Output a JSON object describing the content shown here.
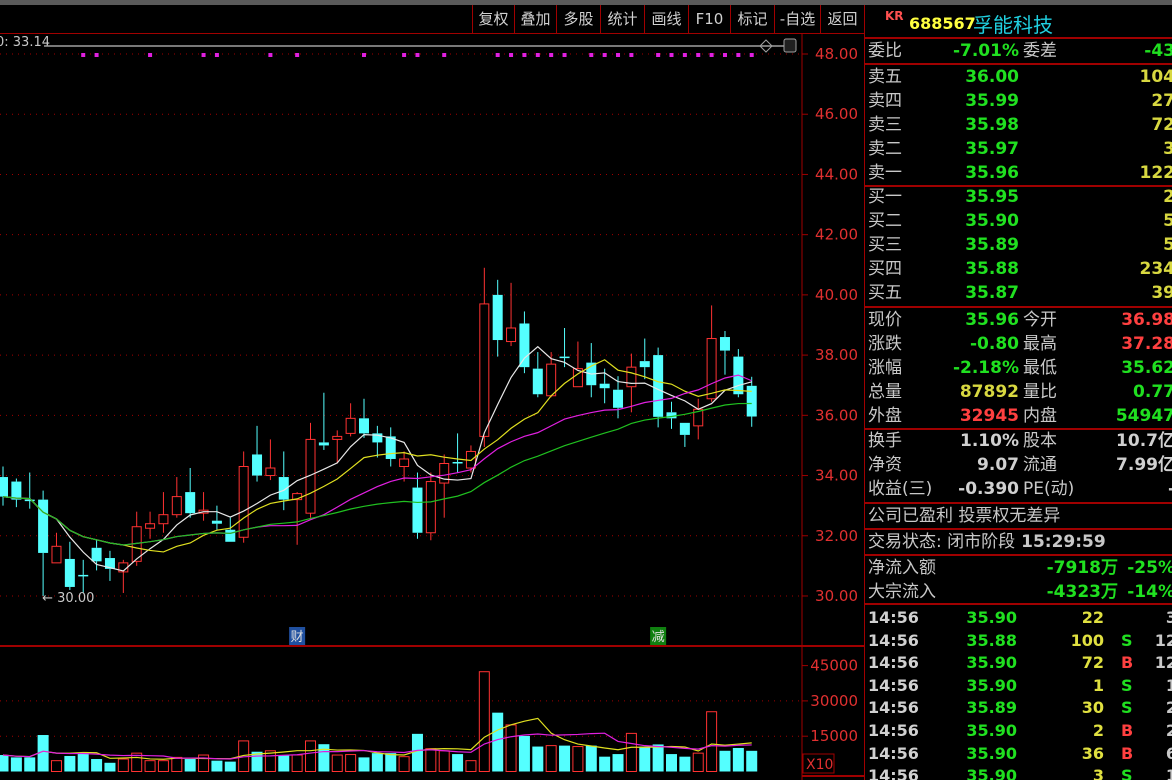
{
  "toolbar": {
    "buttons": [
      "复权",
      "叠加",
      "多股",
      "统计",
      "画线",
      "F10",
      "标记",
      "-自选",
      "返回"
    ]
  },
  "chart_header": {
    "ma_readout": "0: 33.14"
  },
  "stock": {
    "market_tag": "KR",
    "code": "688567",
    "name": "孚能科技"
  },
  "order_book": {
    "weibi": {
      "label": "委比",
      "value": "-7.01%",
      "label2": "委差",
      "value2": "-43"
    },
    "asks": [
      {
        "label": "卖五",
        "price": "36.00",
        "volume": "104"
      },
      {
        "label": "卖四",
        "price": "35.99",
        "volume": "27"
      },
      {
        "label": "卖三",
        "price": "35.98",
        "volume": "72"
      },
      {
        "label": "卖二",
        "price": "35.97",
        "volume": "3"
      },
      {
        "label": "卖一",
        "price": "35.96",
        "volume": "122"
      }
    ],
    "bids": [
      {
        "label": "买一",
        "price": "35.95",
        "volume": "2"
      },
      {
        "label": "买二",
        "price": "35.90",
        "volume": "5"
      },
      {
        "label": "买三",
        "price": "35.89",
        "volume": "5"
      },
      {
        "label": "买四",
        "price": "35.88",
        "volume": "234"
      },
      {
        "label": "买五",
        "price": "35.87",
        "volume": "39"
      }
    ]
  },
  "quote": [
    {
      "label": "现价",
      "value": "35.96",
      "color": "#20e020",
      "label2": "今开",
      "value2": "36.98",
      "color2": "#ff4040"
    },
    {
      "label": "涨跌",
      "value": "-0.80",
      "color": "#20e020",
      "label2": "最高",
      "value2": "37.28",
      "color2": "#ff4040"
    },
    {
      "label": "涨幅",
      "value": "-2.18%",
      "color": "#20e020",
      "label2": "最低",
      "value2": "35.62",
      "color2": "#20e020"
    },
    {
      "label": "总量",
      "value": "87892",
      "color": "#d8d840",
      "label2": "量比",
      "value2": "0.77",
      "color2": "#20e020"
    },
    {
      "label": "外盘",
      "value": "32945",
      "color": "#ff4040",
      "label2": "内盘",
      "value2": "54947",
      "color2": "#20e020"
    }
  ],
  "fundamentals": [
    {
      "label": "换手",
      "value": "1.10%",
      "label2": "股本",
      "value2": "10.7亿"
    },
    {
      "label": "净资",
      "value": "9.07",
      "label2": "流通",
      "value2": "7.99亿"
    },
    {
      "label": "收益(三)",
      "value": "-0.390",
      "label2": "PE(动)",
      "value2": "-"
    }
  ],
  "notice": "公司已盈利 投票权无差异",
  "trade_status": {
    "label": "交易状态: 闭市阶段",
    "time": "15:29:59"
  },
  "fund_flow": [
    {
      "label": "净流入额",
      "value": "-7918万",
      "pct": "-25%"
    },
    {
      "label": "大宗流入",
      "value": "-4323万",
      "pct": "-14%"
    }
  ],
  "ticks": [
    {
      "time": "14:56",
      "price": "35.90",
      "volume": "22",
      "side": "",
      "count": "3"
    },
    {
      "time": "14:56",
      "price": "35.88",
      "volume": "100",
      "side": "S",
      "count": "12"
    },
    {
      "time": "14:56",
      "price": "35.90",
      "volume": "72",
      "side": "B",
      "count": "12"
    },
    {
      "time": "14:56",
      "price": "35.90",
      "volume": "1",
      "side": "S",
      "count": "1"
    },
    {
      "time": "14:56",
      "price": "35.89",
      "volume": "30",
      "side": "S",
      "count": "2"
    },
    {
      "time": "14:56",
      "price": "35.90",
      "volume": "2",
      "side": "B",
      "count": "2"
    },
    {
      "time": "14:56",
      "price": "35.90",
      "volume": "36",
      "side": "B",
      "count": "6"
    },
    {
      "time": "14:56",
      "price": "35.90",
      "volume": "3",
      "side": "S",
      "count": "1"
    }
  ],
  "colors": {
    "up": "#ff3232",
    "down": "#54ffff",
    "axis": "#a00000",
    "axis_text": "#e03030",
    "buy": "#ff4040",
    "sell": "#20e020"
  },
  "chart_data": {
    "type": "candlestick",
    "price_axis": {
      "ticks": [
        "48.00",
        "46.00",
        "44.00",
        "42.00",
        "40.00",
        "38.00",
        "36.00",
        "34.00",
        "32.00",
        "30.00"
      ],
      "range": [
        30,
        48
      ]
    },
    "volume_axis": {
      "ticks": [
        "45000",
        "30000",
        "15000"
      ],
      "range": [
        0,
        45000
      ],
      "unit_label": "X10"
    },
    "low_marker": "30.00",
    "event_markers": [
      {
        "index": 22,
        "text": "财",
        "color": "#2050a0"
      },
      {
        "index": 49,
        "text": "减",
        "color": "#108010"
      }
    ],
    "signal_dots": [
      6,
      7,
      11,
      15,
      16,
      20,
      22,
      27,
      30,
      31,
      33,
      37,
      38,
      39,
      40,
      41,
      42,
      44,
      45,
      46,
      47,
      49,
      50,
      51,
      52,
      53,
      54,
      55,
      56
    ],
    "ohlc": [
      [
        33.95,
        34.3,
        33.0,
        33.3
      ],
      [
        33.8,
        33.9,
        32.95,
        33.2
      ],
      [
        33.2,
        34.1,
        32.9,
        33.2
      ],
      [
        33.2,
        33.5,
        30.0,
        31.43
      ],
      [
        31.1,
        32.1,
        31.1,
        31.65
      ],
      [
        31.23,
        31.8,
        30.2,
        30.3
      ],
      [
        30.7,
        31.2,
        30.1,
        30.7
      ],
      [
        31.6,
        31.85,
        30.85,
        31.15
      ],
      [
        31.26,
        31.5,
        30.5,
        30.9
      ],
      [
        30.8,
        31.2,
        30.1,
        31.1
      ],
      [
        31.15,
        32.8,
        31.0,
        32.3
      ],
      [
        32.25,
        32.8,
        31.9,
        32.4
      ],
      [
        32.4,
        33.45,
        32.1,
        32.7
      ],
      [
        32.7,
        33.95,
        32.6,
        33.3
      ],
      [
        33.45,
        34.25,
        32.6,
        32.75
      ],
      [
        32.75,
        33.45,
        32.5,
        32.85
      ],
      [
        32.5,
        33.0,
        32.2,
        32.4
      ],
      [
        32.2,
        32.6,
        31.8,
        31.8
      ],
      [
        31.95,
        34.8,
        31.77,
        34.3
      ],
      [
        34.7,
        35.65,
        33.8,
        34.0
      ],
      [
        34.0,
        35.2,
        33.85,
        34.25
      ],
      [
        33.95,
        34.8,
        32.85,
        33.2
      ],
      [
        33.2,
        33.45,
        31.7,
        33.4
      ],
      [
        32.75,
        35.75,
        32.6,
        35.2
      ],
      [
        35.1,
        36.75,
        34.85,
        35.0
      ],
      [
        35.2,
        35.5,
        34.4,
        35.3
      ],
      [
        35.4,
        36.4,
        35.3,
        35.9
      ],
      [
        35.9,
        36.55,
        35.25,
        35.4
      ],
      [
        35.4,
        35.65,
        34.6,
        35.1
      ],
      [
        35.3,
        35.6,
        34.3,
        34.55
      ],
      [
        34.3,
        34.8,
        33.8,
        34.55
      ],
      [
        33.6,
        34.1,
        31.9,
        32.1
      ],
      [
        32.1,
        34.1,
        31.85,
        33.8
      ],
      [
        33.75,
        34.7,
        32.6,
        34.4
      ],
      [
        34.45,
        35.4,
        34.1,
        34.4
      ],
      [
        34.25,
        35.0,
        34.1,
        34.8
      ],
      [
        35.3,
        40.9,
        34.95,
        39.7
      ],
      [
        40.0,
        40.5,
        37.95,
        38.5
      ],
      [
        38.45,
        40.4,
        38.3,
        38.9
      ],
      [
        39.05,
        39.45,
        37.4,
        37.6
      ],
      [
        37.55,
        38.1,
        36.6,
        36.7
      ],
      [
        36.65,
        38.1,
        36.6,
        37.7
      ],
      [
        37.95,
        38.9,
        37.6,
        37.9
      ],
      [
        36.95,
        38.45,
        36.95,
        37.55
      ],
      [
        37.75,
        38.4,
        36.6,
        37.0
      ],
      [
        37.05,
        37.55,
        36.4,
        36.9
      ],
      [
        36.85,
        37.3,
        35.9,
        36.25
      ],
      [
        36.95,
        38.05,
        36.1,
        37.6
      ],
      [
        37.8,
        38.55,
        37.2,
        37.6
      ],
      [
        38.0,
        38.25,
        35.6,
        35.95
      ],
      [
        36.1,
        36.45,
        35.55,
        35.9
      ],
      [
        35.75,
        35.75,
        34.95,
        35.35
      ],
      [
        35.65,
        36.55,
        35.2,
        36.2
      ],
      [
        36.55,
        39.65,
        36.45,
        38.55
      ],
      [
        38.6,
        38.8,
        37.35,
        38.15
      ],
      [
        37.95,
        38.2,
        36.6,
        36.7
      ],
      [
        36.98,
        37.28,
        35.62,
        35.96
      ]
    ],
    "volume": [
      7000,
      6000,
      6000,
      15500,
      4600,
      6600,
      7800,
      5300,
      3700,
      5300,
      7800,
      4600,
      4600,
      6000,
      5300,
      7000,
      4600,
      4200,
      13000,
      8400,
      8800,
      7000,
      7000,
      13000,
      11600,
      7000,
      7200,
      6000,
      7800,
      7800,
      6300,
      16000,
      9700,
      8800,
      7400,
      4600,
      42400,
      25000,
      19800,
      15100,
      10600,
      11000,
      11000,
      10600,
      11000,
      6300,
      7400,
      16200,
      10600,
      11500,
      7400,
      6300,
      7800,
      25400,
      8800,
      10000,
      8789
    ],
    "ma_periods": [
      5,
      10,
      20,
      30
    ],
    "ma_colors": [
      "#e8e8e8",
      "#e0e020",
      "#e020e0",
      "#20c020"
    ]
  }
}
